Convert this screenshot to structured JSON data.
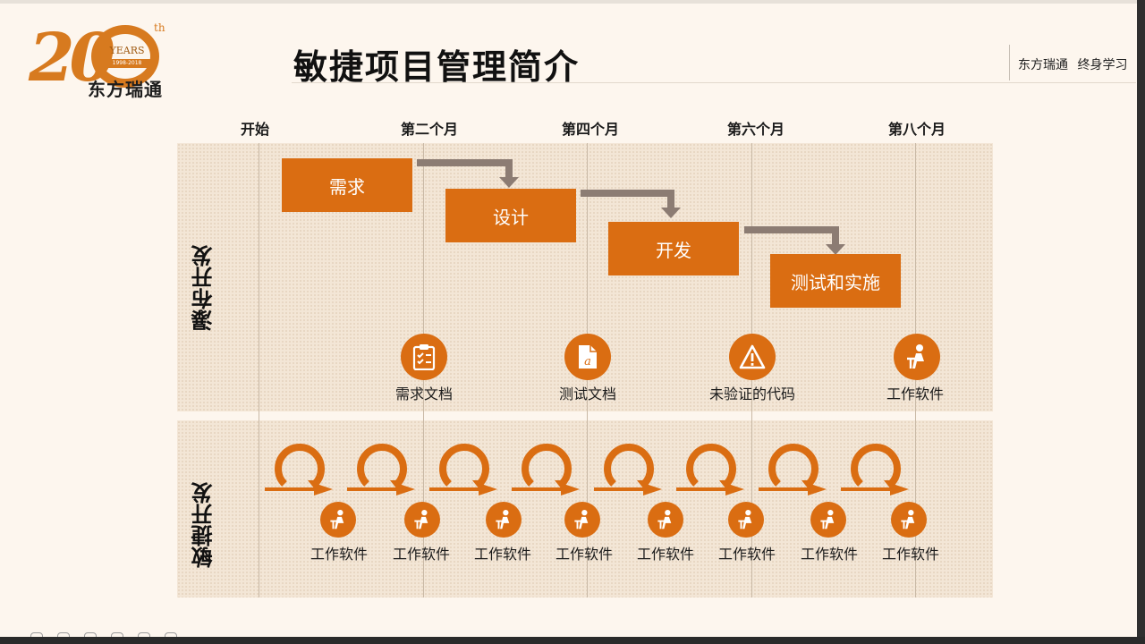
{
  "logo": {
    "number": "20",
    "years": "YEARS",
    "year_range": "1998-2018",
    "suffix": "th",
    "brand": "东方瑞通"
  },
  "header": {
    "title": "敏捷项目管理简介",
    "company_tagline": "东方瑞通 终身学习"
  },
  "timeline": {
    "months": [
      "开始",
      "第二个月",
      "第四个月",
      "第六个月",
      "第八个月"
    ]
  },
  "waterfall": {
    "label": "瀑布开发",
    "phases": [
      "需求",
      "设计",
      "开发",
      "测试和实施"
    ],
    "artifacts": [
      {
        "label": "需求文档",
        "icon": "clipboard-checklist-icon"
      },
      {
        "label": "测试文档",
        "icon": "document-icon"
      },
      {
        "label": "未验证的代码",
        "icon": "warning-triangle-icon"
      },
      {
        "label": "工作软件",
        "icon": "person-at-desk-icon"
      }
    ]
  },
  "agile": {
    "label": "敏捷开发",
    "iteration_label": "工作软件",
    "iteration_icon": "person-at-desk-icon",
    "loop_icon": "iteration-loop-icon",
    "iterations": [
      {
        "label": "工作软件"
      },
      {
        "label": "工作软件"
      },
      {
        "label": "工作软件"
      },
      {
        "label": "工作软件"
      },
      {
        "label": "工作软件"
      },
      {
        "label": "工作软件"
      },
      {
        "label": "工作软件"
      },
      {
        "label": "工作软件"
      }
    ]
  },
  "colors": {
    "accent": "#da6d12",
    "background": "#fdf6ee",
    "lane": "#f3e6d6",
    "arrow": "#8c7c73"
  }
}
